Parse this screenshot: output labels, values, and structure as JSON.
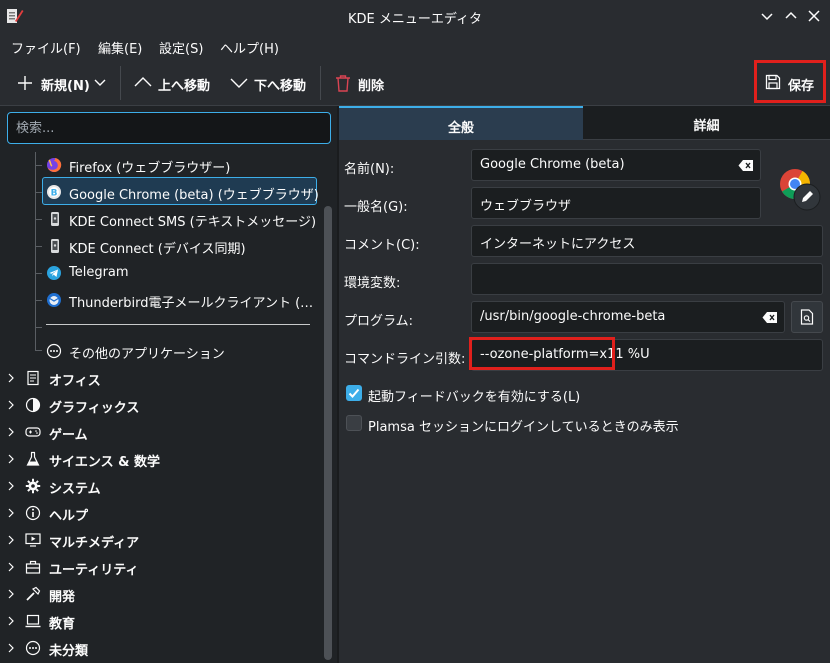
{
  "window": {
    "title": "KDE メニューエディタ"
  },
  "menubar": {
    "items": [
      "ファイル(F)",
      "編集(E)",
      "設定(S)",
      "ヘルプ(H)"
    ]
  },
  "toolbar": {
    "new_label": "新規(N)",
    "move_up_label": "上へ移動",
    "move_down_label": "下へ移動",
    "delete_label": "削除",
    "save_label": "保存"
  },
  "search": {
    "placeholder": "検索..."
  },
  "tree": {
    "apps": [
      {
        "label": "Firefox (ウェブブラウザー)",
        "icon": "firefox-icon"
      },
      {
        "label": "Google Chrome (beta) (ウェブブラウザ)",
        "icon": "chrome-beta-icon"
      },
      {
        "label": "KDE Connect SMS (テキストメッセージ)",
        "icon": "kdeconnect-icon"
      },
      {
        "label": "KDE Connect (デバイス同期)",
        "icon": "kdeconnect-icon"
      },
      {
        "label": "Telegram",
        "icon": "telegram-icon"
      },
      {
        "label": "Thunderbird電子メールクライアント (…",
        "icon": "thunderbird-icon"
      }
    ],
    "other_apps_label": "その他のアプリケーション",
    "categories": [
      {
        "label": "オフィス",
        "icon": "office-icon"
      },
      {
        "label": "グラフィックス",
        "icon": "graphics-icon"
      },
      {
        "label": "ゲーム",
        "icon": "gamepad-icon"
      },
      {
        "label": "サイエンス & 数学",
        "icon": "flask-icon"
      },
      {
        "label": "システム",
        "icon": "gear-icon"
      },
      {
        "label": "ヘルプ",
        "icon": "info-icon"
      },
      {
        "label": "マルチメディア",
        "icon": "monitor-icon"
      },
      {
        "label": "ユーティリティ",
        "icon": "toolbox-icon"
      },
      {
        "label": "開発",
        "icon": "hammer-icon"
      },
      {
        "label": "教育",
        "icon": "laptop-icon"
      },
      {
        "label": "未分類",
        "icon": "more-icon"
      }
    ]
  },
  "tabs": {
    "general": "全般",
    "details": "詳細"
  },
  "form": {
    "name_label": "名前(N):",
    "name_value": "Google Chrome (beta)",
    "generic_name_label": "一般名(G):",
    "generic_name_value": "ウェブブラウザ",
    "comment_label": "コメント(C):",
    "comment_value": "インターネットにアクセス",
    "env_label": "環境変数:",
    "env_value": "",
    "program_label": "プログラム:",
    "program_value": "/usr/bin/google-chrome-beta",
    "cmdline_label": "コマンドライン引数:",
    "cmdline_value": "--ozone-platform=x11 %U",
    "launch_feedback_label": "起動フィードバックを有効にする(L)",
    "launch_feedback_checked": true,
    "plasma_only_label": "Plamsa セッションにログインしているときのみ表示",
    "plasma_only_checked": false
  },
  "colors": {
    "accent": "#3daee9",
    "highlight_box": "#e0201c",
    "delete_red": "#da4453"
  }
}
